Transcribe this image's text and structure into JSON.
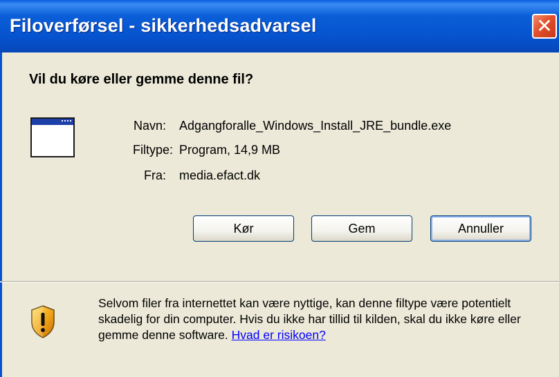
{
  "window": {
    "title": "Filoverførsel - sikkerhedsadvarsel",
    "close_label": "✕"
  },
  "dialog": {
    "question": "Vil du køre eller gemme denne fil?",
    "fields": [
      {
        "label": "Navn:",
        "value": "Adgangforalle_Windows_Install_JRE_bundle.exe"
      },
      {
        "label": "Filtype:",
        "value": "Program, 14,9 MB"
      },
      {
        "label": "Fra:",
        "value": "media.efact.dk"
      }
    ],
    "buttons": {
      "run": "Kør",
      "save": "Gem",
      "cancel": "Annuller"
    }
  },
  "warning": {
    "text": "Selvom filer fra internettet kan være nyttige, kan denne filtype være potentielt skadelig for din computer. Hvis du ikke har tillid til kilden, skal du ikke køre eller gemme denne software.",
    "link": "Hvad er risikoen?"
  },
  "colors": {
    "titlebar": "#0653cf",
    "close": "#e2502c",
    "body": "#ece9d8",
    "link": "#0000ff"
  }
}
